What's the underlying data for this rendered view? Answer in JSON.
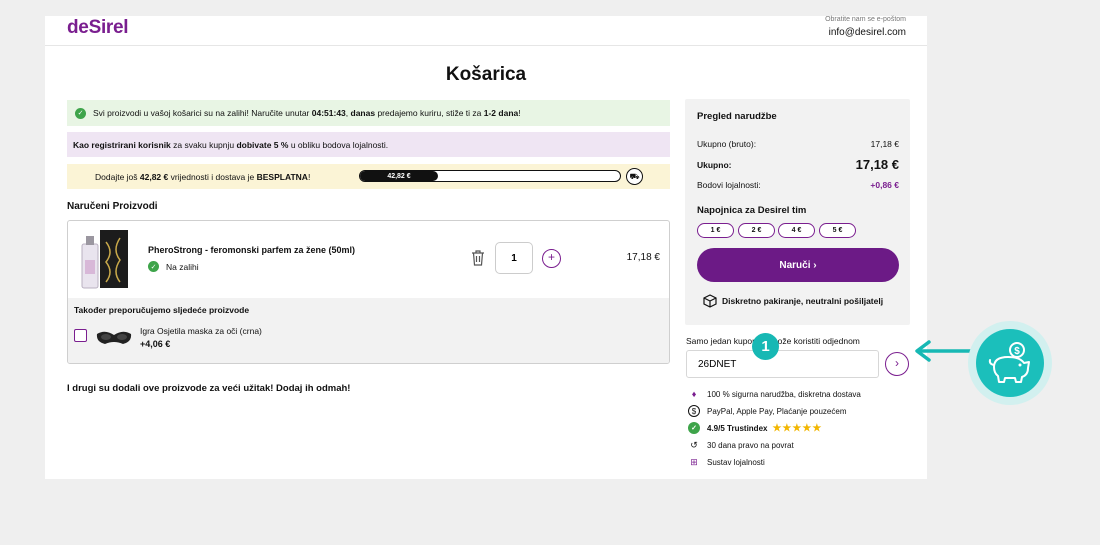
{
  "header": {
    "logo": "deSirel",
    "contact_label": "Obratite nam se e-poštom",
    "contact_email": "info@desirel.com"
  },
  "page_title": "Košarica",
  "banners": {
    "stock": {
      "pre": "Svi proizvodi u vašoj košarici su na zalihi! Naručite unutar ",
      "timer": "04:51:43",
      "mid": ", ",
      "today": "danas",
      "post": " predajemo kuriru, stiže ti za ",
      "days": "1-2 dana",
      "end": "!"
    },
    "loyalty": {
      "reg": "Kao registrirani korisnik",
      "pre": " za svaku kupnju ",
      "get": "dobivate 5 %",
      "post": " u obliku bodova lojalnosti."
    },
    "shipping": {
      "pre": "Dodajte još ",
      "amount": "42,82 €",
      "mid": " vrijednosti i dostava je ",
      "free": "BESPLATNA",
      "end": "!",
      "progress_label": "42,82 €",
      "progress": 0.3
    }
  },
  "ordered": {
    "title": "Naručeni Proizvodi",
    "product": {
      "name": "PheroStrong - feromonski parfem za žene (50ml)",
      "stock": "Na zalihi",
      "qty": "1",
      "price": "17,18 €"
    },
    "recommend": {
      "title": "Također preporučujemo sljedeće proizvode",
      "name": "Igra Osjetila maska za oči (crna)",
      "price": "+4,06 €"
    }
  },
  "others_text": "I drugi su dodali ove proizvode za veći užitak! Dodaj ih odmah!",
  "summary": {
    "title": "Pregled narudžbe",
    "gross_label": "Ukupno (bruto):",
    "gross_value": "17,18 €",
    "total_label": "Ukupno:",
    "total_value": "17,18 €",
    "points_label": "Bodovi lojalnosti:",
    "points_value": "+0,86 €",
    "tip_title": "Napojnica za Desirel tim",
    "tips": [
      "1 €",
      "2 €",
      "4 €",
      "5 €"
    ],
    "order_button": "Naruči",
    "discreet": "Diskretno pakiranje, neutralni pošiljatelj"
  },
  "coupon": {
    "label": "Samo jedan kupon se može koristiti odjednom",
    "value": "26DNET",
    "step": "1"
  },
  "trust": {
    "secure": "100 % sigurna narudžba, diskretna dostava",
    "payment": "PayPal, Apple Pay, Plaćanje pouzećem",
    "rating": "4.9/5 Trustindex",
    "return": "30 dana pravo na povrat",
    "loyalty": "Sustav lojalnosti"
  },
  "colors": {
    "brand": "#7a1e8f",
    "button": "#6c1a86",
    "accent": "#17b8b4",
    "green": "#3ea44a"
  }
}
